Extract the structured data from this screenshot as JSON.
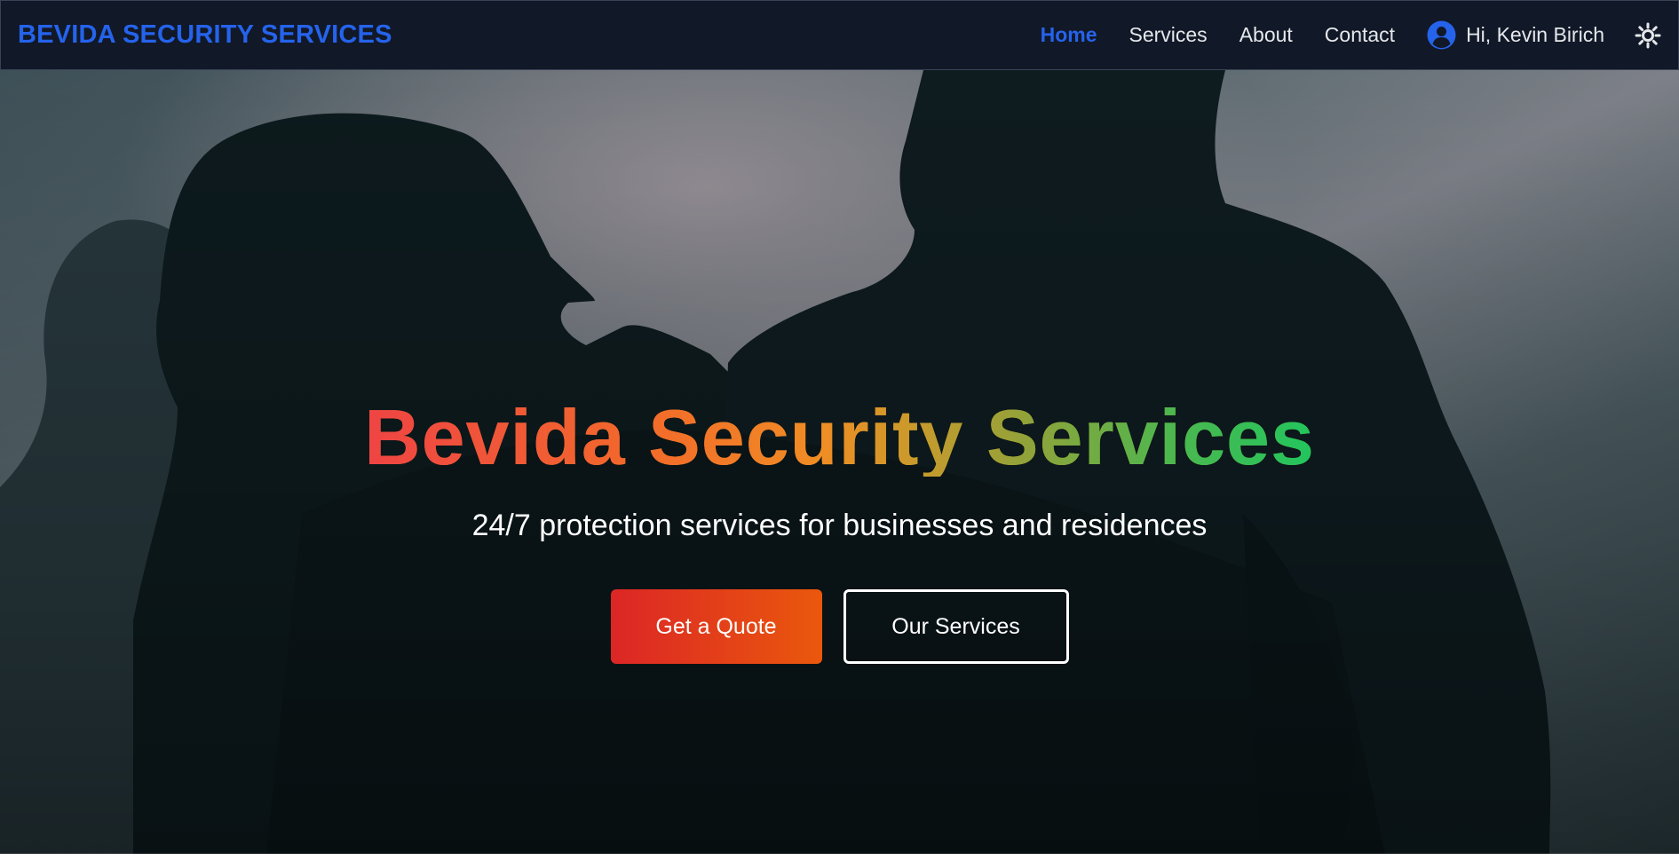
{
  "navbar": {
    "brand": "BEVIDA SECURITY SERVICES",
    "links": [
      {
        "label": "Home",
        "active": true
      },
      {
        "label": "Services",
        "active": false
      },
      {
        "label": "About",
        "active": false
      },
      {
        "label": "Contact",
        "active": false
      }
    ],
    "user_greeting": "Hi, Kevin Birich",
    "user_icon": "user-circle-icon",
    "theme_icon": "sun-icon"
  },
  "hero": {
    "title": "Bevida Security Services",
    "subtitle": "24/7 protection services for businesses and residences",
    "primary_button": "Get a Quote",
    "secondary_button": "Our Services",
    "background_image": "silhouettes-of-security-guards"
  },
  "colors": {
    "navbar_bg": "#111827",
    "accent": "#2563eb",
    "button_gradient_start": "#dc2626",
    "button_gradient_end": "#ea580c",
    "title_gradient_start": "#ef4444",
    "title_gradient_end": "#22c55e"
  }
}
